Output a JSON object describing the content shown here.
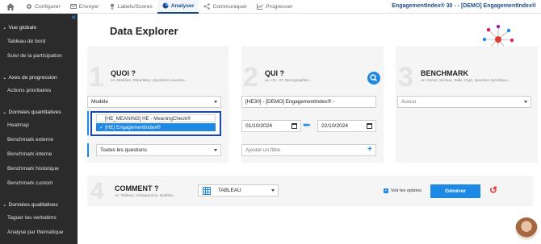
{
  "topnav": {
    "home_icon": "home-icon",
    "items": [
      {
        "label": "Configurer",
        "icon": "gear-icon"
      },
      {
        "label": "Envoyer",
        "icon": "envelope-icon"
      },
      {
        "label": "Labels/Scores",
        "icon": "trophy-icon"
      },
      {
        "label": "Analyser",
        "icon": "pie-chart-icon",
        "active": true
      },
      {
        "label": "Communiquer",
        "icon": "share-icon"
      },
      {
        "label": "Progresser",
        "icon": "line-chart-icon"
      }
    ],
    "project": "EngagementIndex® 30 - - [DEMO] EngagementIndex®"
  },
  "sidebar": {
    "collapse_icon": "double-chevron-left-icon",
    "sections": [
      {
        "label": "Vue globale",
        "items": [
          "Tableau de bord",
          "Suivi de la participation"
        ]
      },
      {
        "label": "Axes de progression",
        "items": [
          "Actions prioritaires"
        ]
      },
      {
        "label": "Données quantitatives",
        "items": [
          "Heatmap",
          "Benchmark externe",
          "Benchmark interne",
          "Benchmark historique",
          "Benchmark custom"
        ]
      },
      {
        "label": "Données qualitatives",
        "items": [
          "Taguer les verbatims",
          "Analyse par thématique"
        ]
      }
    ]
  },
  "page": {
    "title": "Data Explorer"
  },
  "quoi": {
    "number": "1",
    "title": "QUOI ?",
    "subtitle": "ex: Modèles, Répartition, Questions ouvertes...",
    "model_select": "Modèle",
    "dropdown_options": [
      "[HE_MEANING] HE - MeaningCheck®",
      "[HE] EngagementIndex®"
    ],
    "dropdown_selected_index": 1,
    "questions_select": "Toutes les questions"
  },
  "qui": {
    "number": "2",
    "title": "QUI ?",
    "subtitle": "ex: HC, HT, Démographies...",
    "population_select": "[HE30] - [DEMO] EngagementIndex® -",
    "date_start": "01/10/2024",
    "date_end": "22/10/2024",
    "arrows": "▸▸▸",
    "filter_placeholder": "Ajouter un filtre",
    "add_icon": "plus-icon"
  },
  "benchmark": {
    "number": "3",
    "title": "BENCHMARK",
    "subtitle": "ex: Genre, Secteur, Taille, Pays, Question spécifique...",
    "select": "Aucun"
  },
  "comment": {
    "number": "4",
    "title": "COMMENT ?",
    "subtitle": "ex: Tableau, Histogramme, Bubbles...",
    "view_select": "TABLEAU",
    "options_label": "Voir les options",
    "generate_label": "Générer"
  },
  "colors": {
    "accent": "#1e88e5",
    "sidebar": "#2b2b2b",
    "nav_active": "#1a4c8c",
    "dropdown_border": "#1b48b0"
  }
}
